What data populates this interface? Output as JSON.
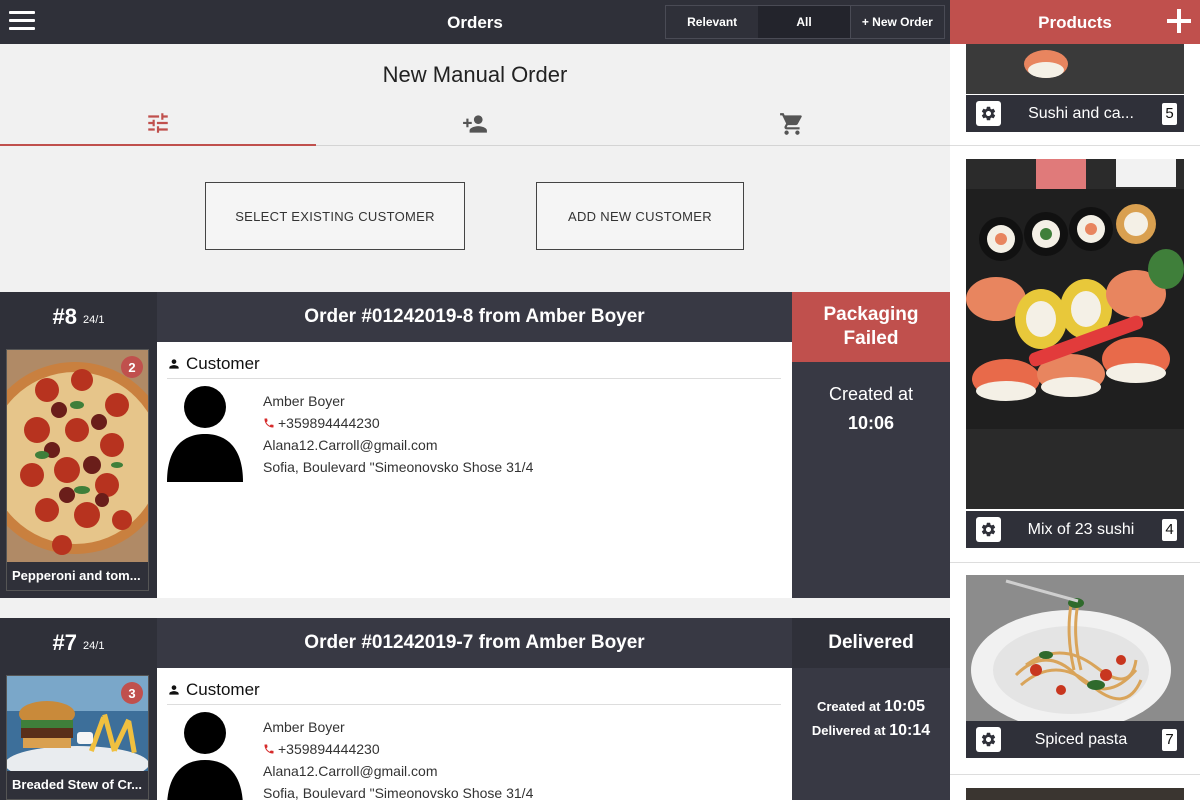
{
  "topbar": {
    "title": "Orders",
    "filters": {
      "relevant": "Relevant",
      "all": "All",
      "new_order": "+ New Order"
    }
  },
  "manual_order": {
    "title": "New Manual Order",
    "tabs": [
      {
        "icon": "sliders-icon",
        "active": true
      },
      {
        "icon": "add-person-icon",
        "active": false
      },
      {
        "icon": "cart-icon",
        "active": false
      }
    ],
    "select_customer_label": "SELECT EXISTING CUSTOMER",
    "add_customer_label": "ADD NEW CUSTOMER"
  },
  "orders": [
    {
      "number": "#8",
      "date": "24/1",
      "header": "Order #01242019-8 from Amber Boyer",
      "status": "Packaging Failed",
      "status_color": "#c0504d",
      "item_name": "Pepperoni and tom...",
      "item_count": "2",
      "customer_heading": "Customer",
      "customer": {
        "name": "Amber Boyer",
        "phone": "+359894444230",
        "email": "Alana12.Carroll@gmail.com",
        "address": "Sofia, Boulevard \"Simeonovsko Shose 31/4"
      },
      "created_label": "Created at",
      "created_time": "10:06"
    },
    {
      "number": "#7",
      "date": "24/1",
      "header": "Order #01242019-7 from Amber Boyer",
      "status": "Delivered",
      "status_color": "#2f3039",
      "item_name": "Breaded Stew of Cr...",
      "item_count": "3",
      "customer_heading": "Customer",
      "customer": {
        "name": "Amber Boyer",
        "phone": "+359894444230",
        "email": "Alana12.Carroll@gmail.com",
        "address": "Sofia, Boulevard \"Simeonovsko Shose 31/4"
      },
      "created_label": "Created at",
      "created_time": "10:05",
      "delivered_label": "Delivered at",
      "delivered_time": "10:14"
    }
  ],
  "products": {
    "title": "Products",
    "items": [
      {
        "name": "Sushi and ca...",
        "count": "5"
      },
      {
        "name": "Mix of 23 sushi",
        "count": "4"
      },
      {
        "name": "Spiced pasta",
        "count": "7"
      }
    ]
  },
  "colors": {
    "dark": "#2f3039",
    "accent": "#c0504d",
    "panel": "#383944"
  }
}
